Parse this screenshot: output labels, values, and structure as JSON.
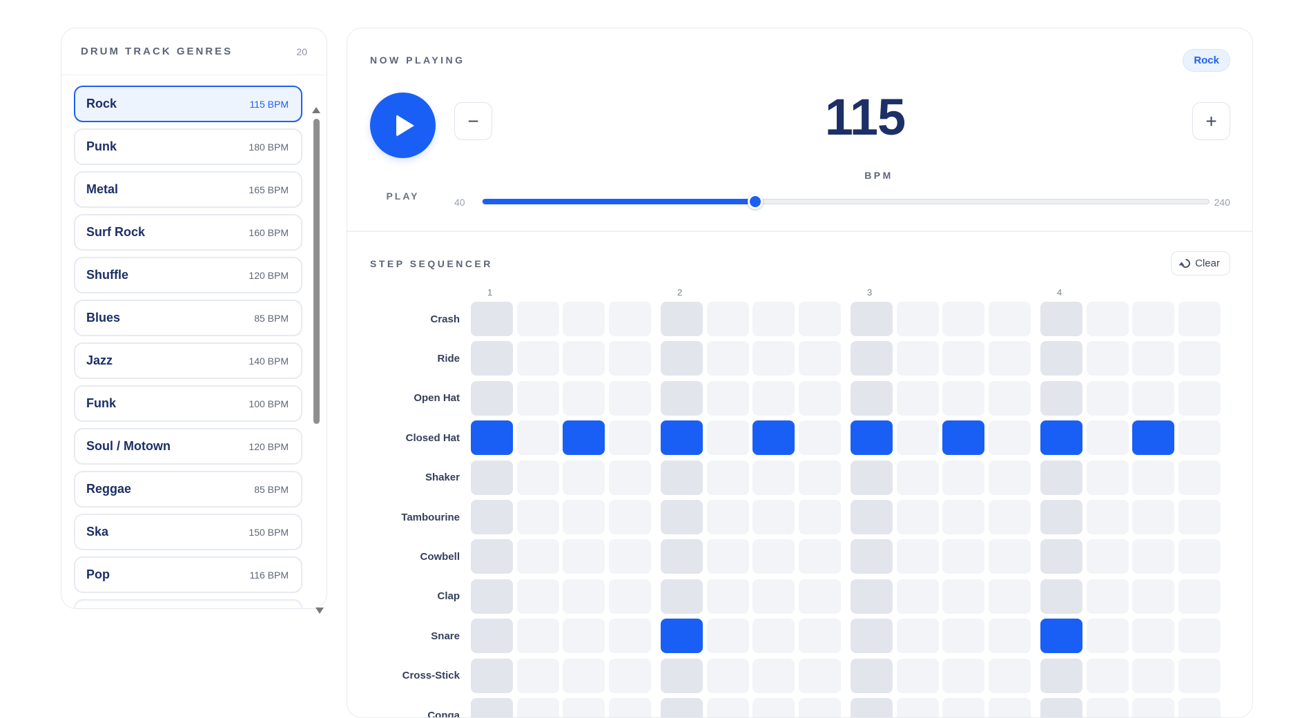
{
  "genres_panel": {
    "title": "DRUM TRACK GENRES",
    "count": "20",
    "items": [
      {
        "name": "Rock",
        "bpm": "115 BPM",
        "active": true
      },
      {
        "name": "Punk",
        "bpm": "180 BPM"
      },
      {
        "name": "Metal",
        "bpm": "165 BPM"
      },
      {
        "name": "Surf Rock",
        "bpm": "160 BPM"
      },
      {
        "name": "Shuffle",
        "bpm": "120 BPM"
      },
      {
        "name": "Blues",
        "bpm": "85 BPM"
      },
      {
        "name": "Jazz",
        "bpm": "140 BPM"
      },
      {
        "name": "Funk",
        "bpm": "100 BPM"
      },
      {
        "name": "Soul / Motown",
        "bpm": "120 BPM"
      },
      {
        "name": "Reggae",
        "bpm": "85 BPM"
      },
      {
        "name": "Ska",
        "bpm": "150 BPM"
      },
      {
        "name": "Pop",
        "bpm": "116 BPM"
      }
    ]
  },
  "now_playing": {
    "label": "NOW PLAYING",
    "badge": "Rock",
    "play_label": "PLAY",
    "minus_label": "−",
    "plus_label": "+",
    "bpm": "115",
    "bpm_unit": "BPM",
    "slider": {
      "min": "40",
      "max": "240",
      "value": 115
    }
  },
  "sequencer": {
    "label": "STEP SEQUENCER",
    "clear_label": "Clear",
    "beat_numbers": [
      "1",
      "2",
      "3",
      "4"
    ],
    "rows": [
      {
        "name": "Crash",
        "steps": [
          0,
          0,
          0,
          0,
          0,
          0,
          0,
          0,
          0,
          0,
          0,
          0,
          0,
          0,
          0,
          0
        ]
      },
      {
        "name": "Ride",
        "steps": [
          0,
          0,
          0,
          0,
          0,
          0,
          0,
          0,
          0,
          0,
          0,
          0,
          0,
          0,
          0,
          0
        ]
      },
      {
        "name": "Open Hat",
        "steps": [
          0,
          0,
          0,
          0,
          0,
          0,
          0,
          0,
          0,
          0,
          0,
          0,
          0,
          0,
          0,
          0
        ]
      },
      {
        "name": "Closed Hat",
        "steps": [
          1,
          0,
          1,
          0,
          1,
          0,
          1,
          0,
          1,
          0,
          1,
          0,
          1,
          0,
          1,
          0
        ]
      },
      {
        "name": "Shaker",
        "steps": [
          0,
          0,
          0,
          0,
          0,
          0,
          0,
          0,
          0,
          0,
          0,
          0,
          0,
          0,
          0,
          0
        ]
      },
      {
        "name": "Tambourine",
        "steps": [
          0,
          0,
          0,
          0,
          0,
          0,
          0,
          0,
          0,
          0,
          0,
          0,
          0,
          0,
          0,
          0
        ]
      },
      {
        "name": "Cowbell",
        "steps": [
          0,
          0,
          0,
          0,
          0,
          0,
          0,
          0,
          0,
          0,
          0,
          0,
          0,
          0,
          0,
          0
        ]
      },
      {
        "name": "Clap",
        "steps": [
          0,
          0,
          0,
          0,
          0,
          0,
          0,
          0,
          0,
          0,
          0,
          0,
          0,
          0,
          0,
          0
        ]
      },
      {
        "name": "Snare",
        "steps": [
          0,
          0,
          0,
          0,
          1,
          0,
          0,
          0,
          0,
          0,
          0,
          0,
          1,
          0,
          0,
          0
        ]
      },
      {
        "name": "Cross-Stick",
        "steps": [
          0,
          0,
          0,
          0,
          0,
          0,
          0,
          0,
          0,
          0,
          0,
          0,
          0,
          0,
          0,
          0
        ]
      },
      {
        "name": "Conga",
        "steps": [
          0,
          0,
          0,
          0,
          0,
          0,
          0,
          0,
          0,
          0,
          0,
          0,
          0,
          0,
          0,
          0
        ]
      }
    ]
  },
  "colors": {
    "accent": "#1a5ff5",
    "text_dark": "#1c2f66",
    "cell_idle": "#f2f4f7",
    "cell_beat": "#e2e6ec"
  },
  "icons": {
    "play": "play-icon",
    "clear": "refresh-icon",
    "scroll_up": "caret-up-icon",
    "scroll_down": "caret-down-icon"
  }
}
